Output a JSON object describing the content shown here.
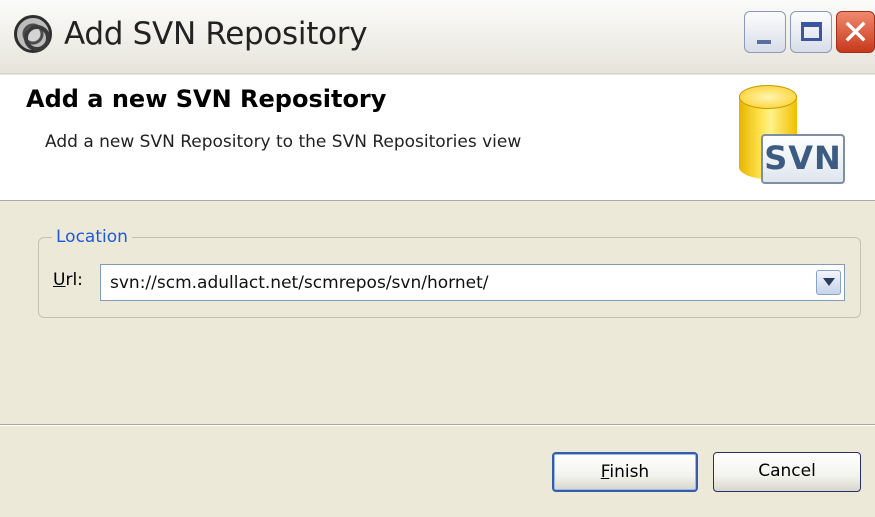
{
  "window": {
    "title": "Add SVN Repository",
    "app_icon": "gear-icon",
    "controls": {
      "minimize": "_",
      "maximize": "☐",
      "close": "✕"
    }
  },
  "banner": {
    "title": "Add a new SVN Repository",
    "description": "Add a new SVN Repository to the SVN Repositories view",
    "logo_text": "SVN"
  },
  "location": {
    "group_label": "Location",
    "url_label_mnemonic": "U",
    "url_label_rest": "rl:",
    "url_value": "svn://scm.adullact.net/scmrepos/svn/hornet/"
  },
  "buttons": {
    "finish_mnemonic": "F",
    "finish_rest": "inish",
    "cancel": "Cancel"
  },
  "colors": {
    "accent": "#1c5ad6",
    "window_bg": "#ece9d8",
    "close_red": "#c8381c"
  }
}
